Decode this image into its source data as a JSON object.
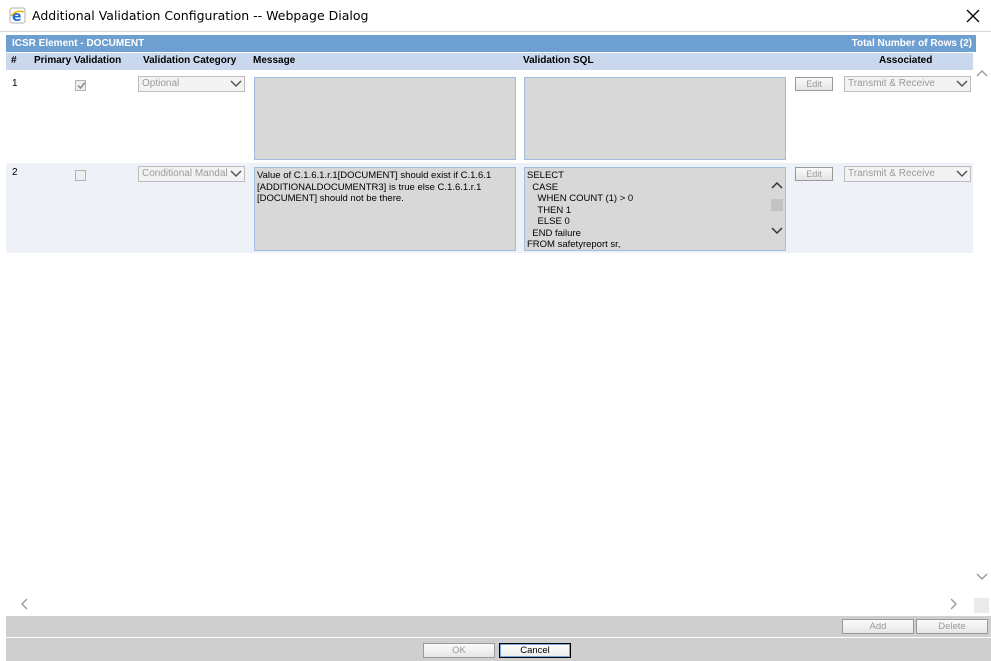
{
  "window": {
    "title": "Additional Validation Configuration -- Webpage Dialog",
    "icon": "ie-icon",
    "close_icon": "close-icon"
  },
  "section": {
    "title": "ICSR Element - DOCUMENT",
    "total_rows": "Total Number of Rows (2)",
    "header_color": "#6e9fd1"
  },
  "columns": {
    "num": "#",
    "primary_validation": "Primary Validation",
    "validation_category": "Validation Category",
    "message": "Message",
    "validation_sql": "Validation SQL",
    "associated": "Associated"
  },
  "rows": [
    {
      "num": "1",
      "primary_checked": true,
      "category": "Optional",
      "message": "",
      "sql": [],
      "edit_label": "Edit",
      "associated": "Transmit & Receive"
    },
    {
      "num": "2",
      "primary_checked": false,
      "category": "Conditional Mandal",
      "message": "Value of C.1.6.1.r.1[DOCUMENT] should exist if C.1.6.1 [ADDITIONALDOCUMENTR3] is true else C.1.6.1.r.1 [DOCUMENT] should not be there.",
      "sql": [
        "SELECT",
        "  CASE",
        "    WHEN COUNT (1) > 0",
        "    THEN 1",
        "    ELSE 0",
        "  END failure",
        "FROM safetyreport sr,"
      ],
      "edit_label": "Edit",
      "associated": "Transmit & Receive"
    }
  ],
  "actions": {
    "add": "Add",
    "delete": "Delete",
    "ok": "OK",
    "cancel": "Cancel"
  }
}
